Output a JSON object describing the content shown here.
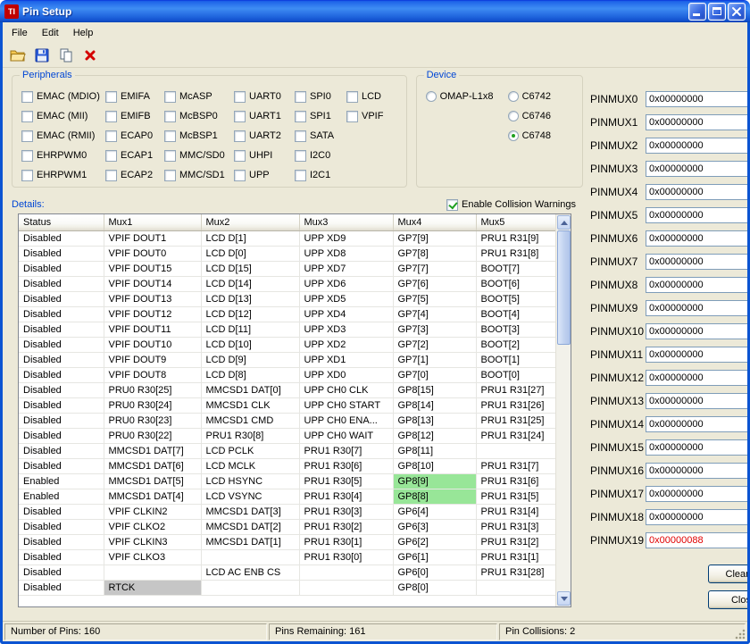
{
  "colors": {
    "highlight_green": "#98E698",
    "highlight_gray": "#C6C6C6",
    "error_text": "#E00000",
    "accent_blue": "#0046D5"
  },
  "window": {
    "title": "Pin Setup"
  },
  "menu": {
    "items": [
      "File",
      "Edit",
      "Help"
    ]
  },
  "peripherals": {
    "label": "Peripherals",
    "columns": [
      [
        "EMAC (MDIO)",
        "EMAC (MII)",
        "EMAC (RMII)",
        "EHRPWM0",
        "EHRPWM1"
      ],
      [
        "EMIFA",
        "EMIFB",
        "ECAP0",
        "ECAP1",
        "ECAP2"
      ],
      [
        "McASP",
        "McBSP0",
        "McBSP1",
        "MMC/SD0",
        "MMC/SD1"
      ],
      [
        "UART0",
        "UART1",
        "UART2",
        "UHPI",
        "UPP"
      ],
      [
        "SPI0",
        "SPI1",
        "SATA",
        "I2C0",
        "I2C1"
      ],
      [
        "LCD",
        "VPIF"
      ]
    ]
  },
  "device": {
    "label": "Device",
    "columns": [
      [
        {
          "label": "OMAP-L1x8",
          "selected": false
        }
      ],
      [
        {
          "label": "C6742",
          "selected": false
        },
        {
          "label": "C6746",
          "selected": false
        },
        {
          "label": "C6748",
          "selected": true
        }
      ]
    ]
  },
  "collision": {
    "label": "Enable Collision Warnings",
    "checked": true
  },
  "details": {
    "label": "Details:",
    "columns": [
      "Status",
      "Mux1",
      "Mux2",
      "Mux3",
      "Mux4",
      "Mux5"
    ],
    "rows": [
      {
        "cells": [
          "Disabled",
          "VPIF DOUT1",
          "LCD D[1]",
          "UPP XD9",
          "GP7[9]",
          "PRU1 R31[9]"
        ]
      },
      {
        "cells": [
          "Disabled",
          "VPIF DOUT0",
          "LCD D[0]",
          "UPP XD8",
          "GP7[8]",
          "PRU1 R31[8]"
        ]
      },
      {
        "cells": [
          "Disabled",
          "VPIF DOUT15",
          "LCD D[15]",
          "UPP XD7",
          "GP7[7]",
          "BOOT[7]"
        ]
      },
      {
        "cells": [
          "Disabled",
          "VPIF DOUT14",
          "LCD D[14]",
          "UPP XD6",
          "GP7[6]",
          "BOOT[6]"
        ]
      },
      {
        "cells": [
          "Disabled",
          "VPIF DOUT13",
          "LCD D[13]",
          "UPP XD5",
          "GP7[5]",
          "BOOT[5]"
        ]
      },
      {
        "cells": [
          "Disabled",
          "VPIF DOUT12",
          "LCD D[12]",
          "UPP XD4",
          "GP7[4]",
          "BOOT[4]"
        ]
      },
      {
        "cells": [
          "Disabled",
          "VPIF DOUT11",
          "LCD D[11]",
          "UPP XD3",
          "GP7[3]",
          "BOOT[3]"
        ]
      },
      {
        "cells": [
          "Disabled",
          "VPIF DOUT10",
          "LCD D[10]",
          "UPP XD2",
          "GP7[2]",
          "BOOT[2]"
        ]
      },
      {
        "cells": [
          "Disabled",
          "VPIF DOUT9",
          "LCD D[9]",
          "UPP XD1",
          "GP7[1]",
          "BOOT[1]"
        ]
      },
      {
        "cells": [
          "Disabled",
          "VPIF DOUT8",
          "LCD D[8]",
          "UPP XD0",
          "GP7[0]",
          "BOOT[0]"
        ]
      },
      {
        "cells": [
          "Disabled",
          "PRU0 R30[25]",
          "MMCSD1 DAT[0]",
          "UPP CH0 CLK",
          "GP8[15]",
          "PRU1 R31[27]"
        ]
      },
      {
        "cells": [
          "Disabled",
          "PRU0 R30[24]",
          "MMCSD1 CLK",
          "UPP CH0 START",
          "GP8[14]",
          "PRU1 R31[26]"
        ]
      },
      {
        "cells": [
          "Disabled",
          "PRU0 R30[23]",
          "MMCSD1 CMD",
          "UPP CH0 ENA...",
          "GP8[13]",
          "PRU1 R31[25]"
        ]
      },
      {
        "cells": [
          "Disabled",
          "PRU0 R30[22]",
          "PRU1 R30[8]",
          "UPP CH0 WAIT",
          "GP8[12]",
          "PRU1 R31[24]"
        ]
      },
      {
        "cells": [
          "Disabled",
          "MMCSD1 DAT[7]",
          "LCD PCLK",
          "PRU1 R30[7]",
          "GP8[11]",
          ""
        ]
      },
      {
        "cells": [
          "Disabled",
          "MMCSD1 DAT[6]",
          "LCD MCLK",
          "PRU1 R30[6]",
          "GP8[10]",
          "PRU1 R31[7]"
        ]
      },
      {
        "cells": [
          "Enabled",
          "MMCSD1 DAT[5]",
          "LCD HSYNC",
          "PRU1 R30[5]",
          "GP8[9]",
          "PRU1 R31[6]"
        ],
        "highlight": {
          "col": 4,
          "type": "green"
        }
      },
      {
        "cells": [
          "Enabled",
          "MMCSD1 DAT[4]",
          "LCD VSYNC",
          "PRU1 R30[4]",
          "GP8[8]",
          "PRU1 R31[5]"
        ],
        "highlight": {
          "col": 4,
          "type": "green"
        }
      },
      {
        "cells": [
          "Disabled",
          "VPIF CLKIN2",
          "MMCSD1 DAT[3]",
          "PRU1 R30[3]",
          "GP6[4]",
          "PRU1 R31[4]"
        ]
      },
      {
        "cells": [
          "Disabled",
          "VPIF CLKO2",
          "MMCSD1 DAT[2]",
          "PRU1 R30[2]",
          "GP6[3]",
          "PRU1 R31[3]"
        ]
      },
      {
        "cells": [
          "Disabled",
          "VPIF CLKIN3",
          "MMCSD1 DAT[1]",
          "PRU1 R30[1]",
          "GP6[2]",
          "PRU1 R31[2]"
        ]
      },
      {
        "cells": [
          "Disabled",
          "VPIF CLKO3",
          "",
          "PRU1 R30[0]",
          "GP6[1]",
          "PRU1 R31[1]"
        ]
      },
      {
        "cells": [
          "Disabled",
          "",
          "LCD AC ENB CS",
          "",
          "GP6[0]",
          "PRU1 R31[28]"
        ]
      },
      {
        "cells": [
          "Disabled",
          "RTCK",
          "",
          "",
          "GP8[0]",
          ""
        ],
        "highlight": {
          "col": 1,
          "type": "gray"
        }
      }
    ]
  },
  "pinmux": {
    "entries": [
      {
        "label": "PINMUX0",
        "value": "0x00000000",
        "error": false
      },
      {
        "label": "PINMUX1",
        "value": "0x00000000",
        "error": false
      },
      {
        "label": "PINMUX2",
        "value": "0x00000000",
        "error": false
      },
      {
        "label": "PINMUX3",
        "value": "0x00000000",
        "error": false
      },
      {
        "label": "PINMUX4",
        "value": "0x00000000",
        "error": false
      },
      {
        "label": "PINMUX5",
        "value": "0x00000000",
        "error": false
      },
      {
        "label": "PINMUX6",
        "value": "0x00000000",
        "error": false
      },
      {
        "label": "PINMUX7",
        "value": "0x00000000",
        "error": false
      },
      {
        "label": "PINMUX8",
        "value": "0x00000000",
        "error": false
      },
      {
        "label": "PINMUX9",
        "value": "0x00000000",
        "error": false
      },
      {
        "label": "PINMUX10",
        "value": "0x00000000",
        "error": false
      },
      {
        "label": "PINMUX11",
        "value": "0x00000000",
        "error": false
      },
      {
        "label": "PINMUX12",
        "value": "0x00000000",
        "error": false
      },
      {
        "label": "PINMUX13",
        "value": "0x00000000",
        "error": false
      },
      {
        "label": "PINMUX14",
        "value": "0x00000000",
        "error": false
      },
      {
        "label": "PINMUX15",
        "value": "0x00000000",
        "error": false
      },
      {
        "label": "PINMUX16",
        "value": "0x00000000",
        "error": false
      },
      {
        "label": "PINMUX17",
        "value": "0x00000000",
        "error": false
      },
      {
        "label": "PINMUX18",
        "value": "0x00000000",
        "error": false
      },
      {
        "label": "PINMUX19",
        "value": "0x00000088",
        "error": true
      }
    ]
  },
  "buttons": {
    "clear_all": "Clear All",
    "close": "Close"
  },
  "status": {
    "number_of_pins": "Number of Pins: 160",
    "pins_remaining": "Pins Remaining: 161",
    "pin_collisions": "Pin Collisions: 2"
  }
}
